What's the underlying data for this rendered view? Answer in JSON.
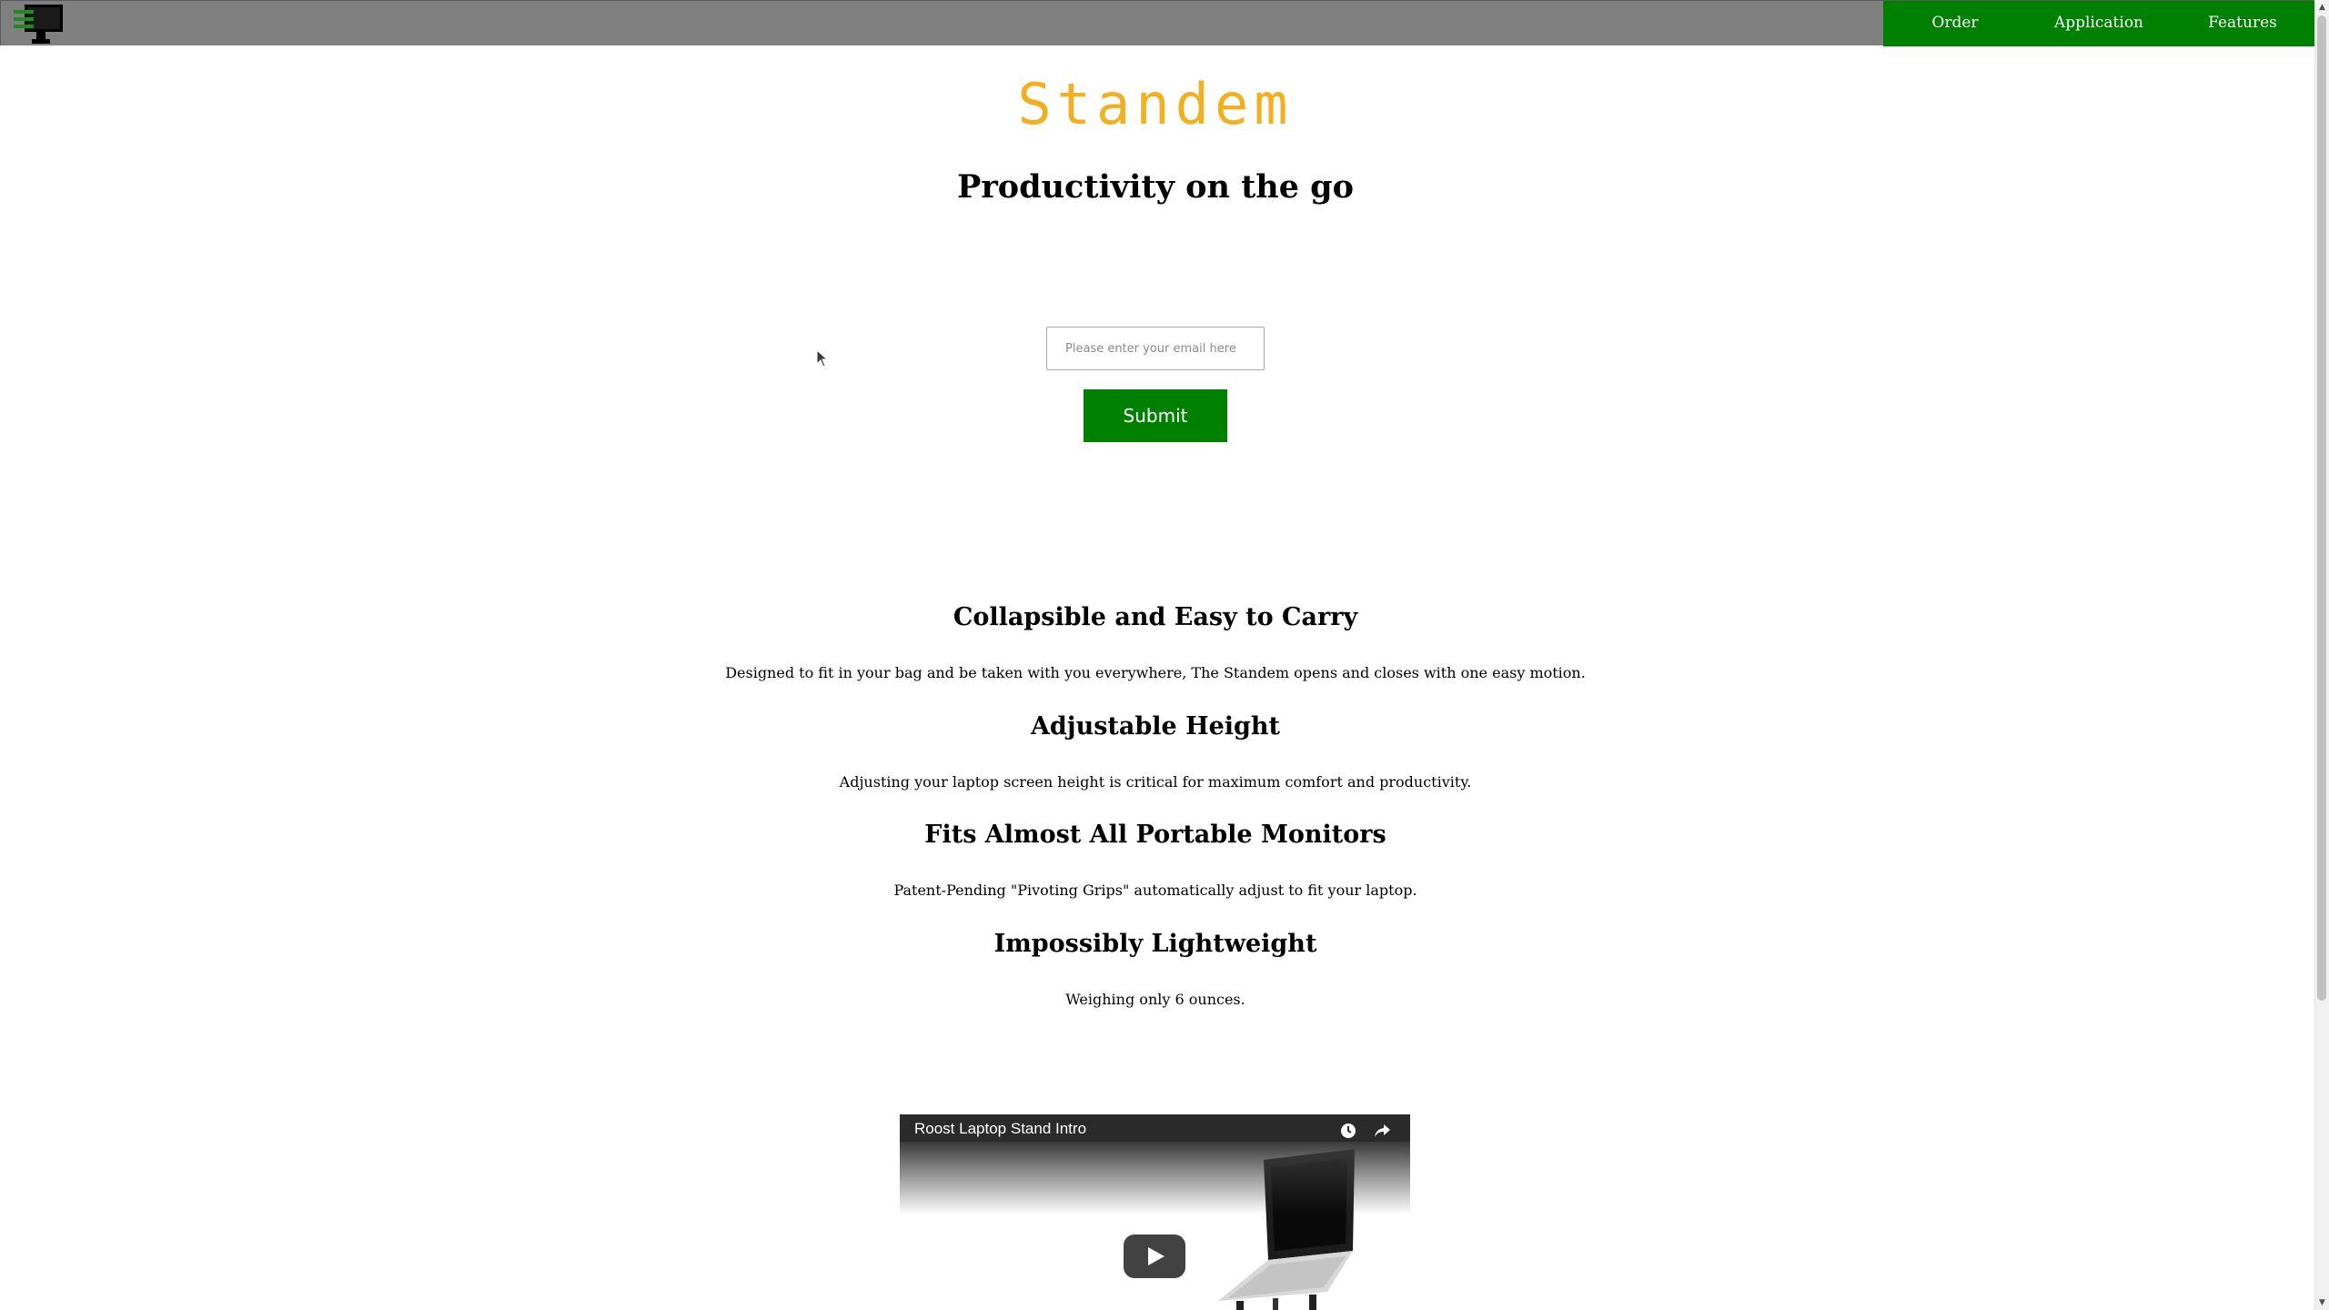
{
  "nav": {
    "items": [
      {
        "label": "Order"
      },
      {
        "label": "Application"
      },
      {
        "label": "Features"
      }
    ]
  },
  "hero": {
    "brand": "Standem",
    "tagline": "Productivity on the go"
  },
  "signup": {
    "email_placeholder": "Please enter your email here",
    "email_value": "",
    "submit_label": "Submit"
  },
  "features": [
    {
      "heading": "Collapsible and Easy to Carry",
      "text": "Designed to fit in your bag and be taken with you everywhere, The Standem opens and closes with one easy motion."
    },
    {
      "heading": "Adjustable Height",
      "text": "Adjusting your laptop screen height is critical for maximum comfort and productivity."
    },
    {
      "heading": "Fits Almost All Portable Monitors",
      "text": "Patent-Pending \"Pivoting Grips\" automatically adjust to fit your laptop."
    },
    {
      "heading": "Impossibly Lightweight",
      "text": "Weighing only 6 ounces."
    }
  ],
  "video": {
    "title": "Roost Laptop Stand Intro",
    "icons": [
      "watch-later-icon",
      "share-icon",
      "play-icon"
    ]
  },
  "colors": {
    "topbar": "#808080",
    "nav": "#008000",
    "brand": "#f0b020",
    "submit": "#008000"
  },
  "icons": {
    "logo": "monitor-menu-icon",
    "cursor": "mouse-pointer-icon"
  }
}
